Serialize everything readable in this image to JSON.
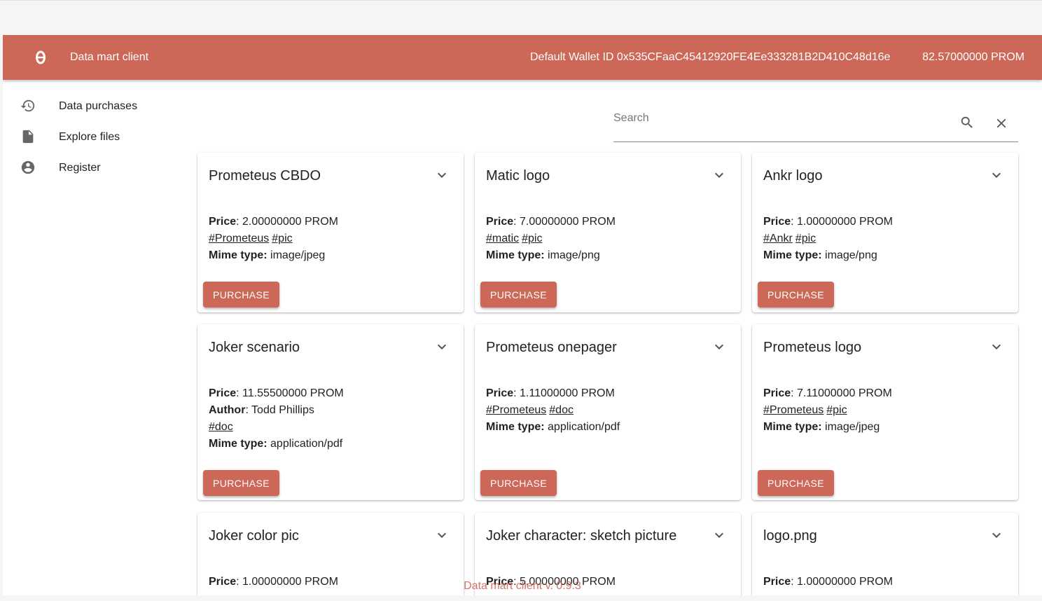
{
  "header": {
    "title": "Data mart client",
    "wallet": "Default Wallet ID 0x535CFaaC45412920FE4Ee333281B2D410C48d16e",
    "balance": "82.57000000 PROM",
    "accent": "#cd6758"
  },
  "sidebar": {
    "items": [
      {
        "label": "Data purchases",
        "icon": "history-icon"
      },
      {
        "label": "Explore files",
        "icon": "file-icon"
      },
      {
        "label": "Register",
        "icon": "account-circle-icon"
      }
    ]
  },
  "search": {
    "placeholder": "Search"
  },
  "labels": {
    "price": "Price",
    "author": "Author",
    "mime": "Mime type:",
    "purchase": "PURCHASE"
  },
  "cards": [
    {
      "title": "Prometeus CBDO",
      "price": "2.00000000 PROM",
      "tags": [
        "#Prometeus",
        "#pic"
      ],
      "mime": "image/jpeg"
    },
    {
      "title": "Matic logo",
      "price": "7.00000000 PROM",
      "tags": [
        "#matic",
        "#pic"
      ],
      "mime": "image/png"
    },
    {
      "title": "Ankr logo",
      "price": "1.00000000 PROM",
      "tags": [
        "#Ankr",
        "#pic"
      ],
      "mime": "image/png"
    },
    {
      "title": "Joker scenario",
      "price": "11.55500000 PROM",
      "author": "Todd Phillips",
      "tags": [
        "#doc"
      ],
      "mime": "application/pdf"
    },
    {
      "title": "Prometeus onepager",
      "price": "1.11000000 PROM",
      "tags": [
        "#Prometeus",
        "#doc"
      ],
      "mime": "application/pdf"
    },
    {
      "title": "Prometeus logo",
      "price": "7.11000000 PROM",
      "tags": [
        "#Prometeus",
        "#pic"
      ],
      "mime": "image/jpeg"
    },
    {
      "title": "Joker color pic",
      "price": "1.00000000 PROM"
    },
    {
      "title": "Joker character: sketch picture",
      "price": "5.00000000 PROM"
    },
    {
      "title": "logo.png",
      "price": "1.00000000 PROM"
    }
  ],
  "footer": "Data mart client v. 0.9.3"
}
